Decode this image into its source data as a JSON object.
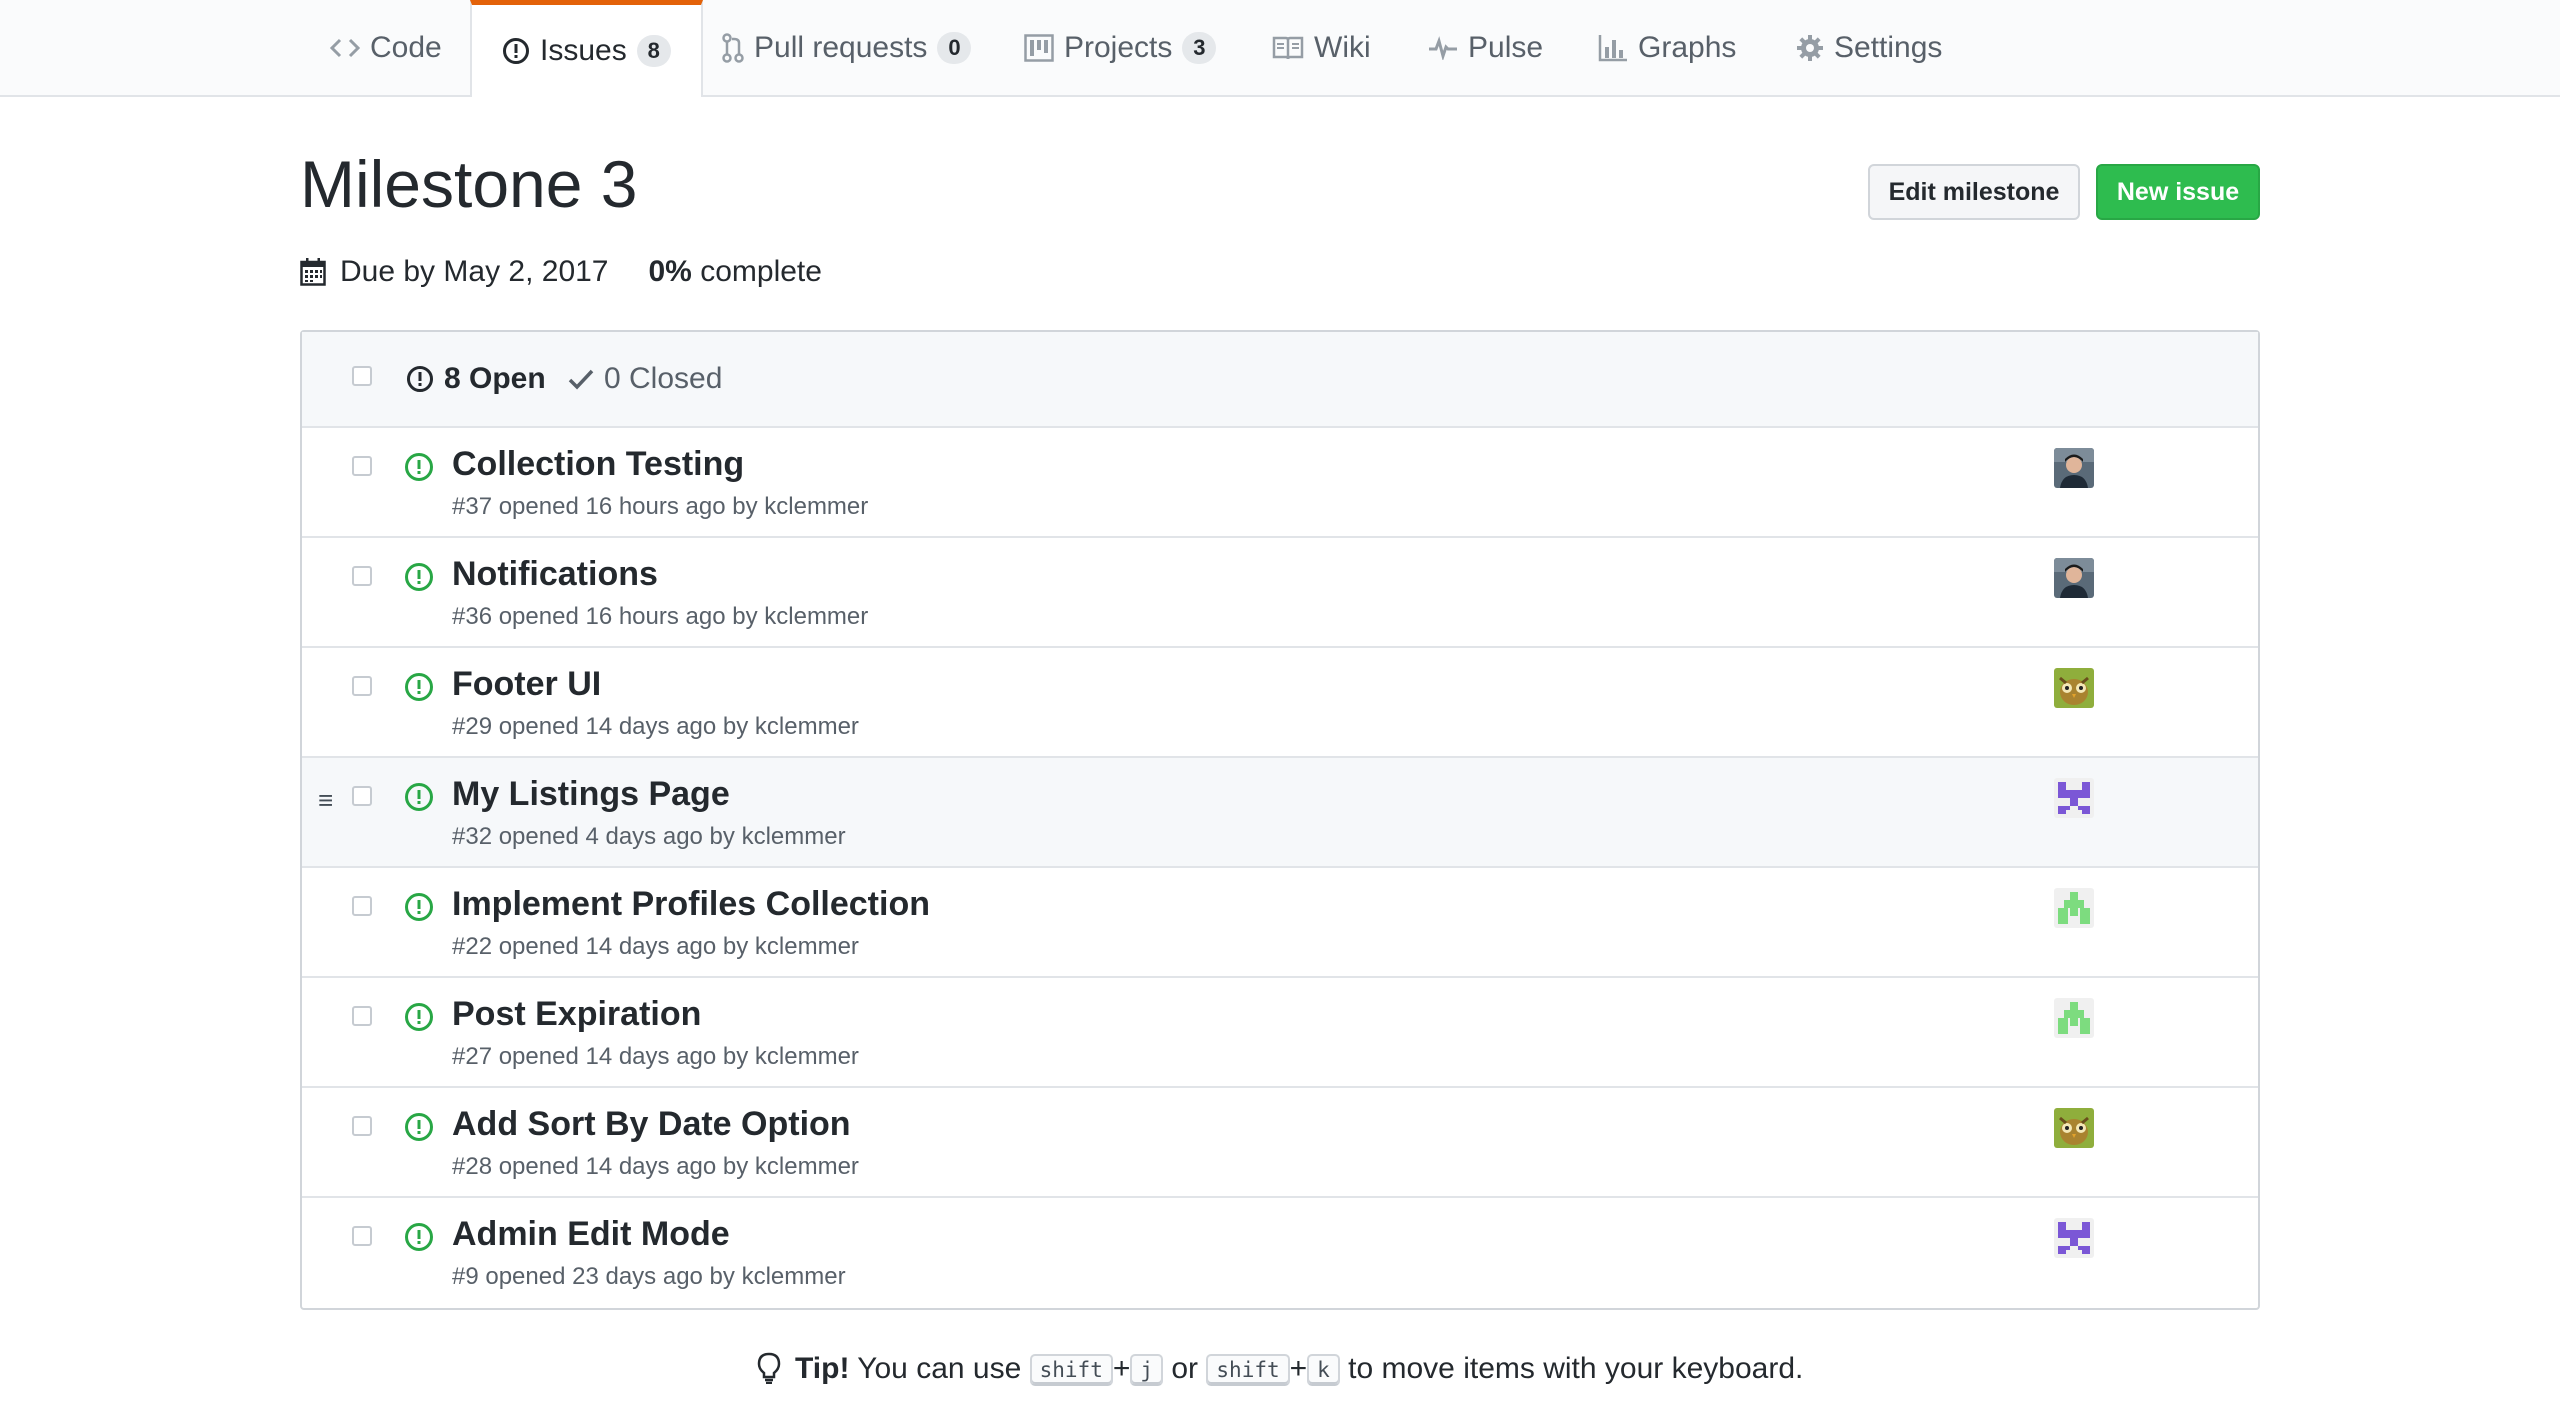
{
  "tabs": [
    {
      "label": "Code",
      "icon": "code-icon"
    },
    {
      "label": "Issues",
      "icon": "issue-opened-icon",
      "count": "8",
      "selected": true
    },
    {
      "label": "Pull requests",
      "icon": "git-pull-request-icon",
      "count": "0"
    },
    {
      "label": "Projects",
      "icon": "project-icon",
      "count": "3"
    },
    {
      "label": "Wiki",
      "icon": "book-icon"
    },
    {
      "label": "Pulse",
      "icon": "pulse-icon"
    },
    {
      "label": "Graphs",
      "icon": "graph-icon"
    },
    {
      "label": "Settings",
      "icon": "gear-icon"
    }
  ],
  "milestone": {
    "title": "Milestone 3",
    "due": "Due by May 2, 2017",
    "percent": "0%",
    "complete_label": "complete",
    "edit_label": "Edit milestone",
    "new_issue_label": "New issue"
  },
  "states": {
    "open_label": "8 Open",
    "closed_label": "0 Closed"
  },
  "issues": [
    {
      "title": "Collection Testing",
      "meta": "#37 opened 16 hours ago by kclemmer",
      "avatar": "photo"
    },
    {
      "title": "Notifications",
      "meta": "#36 opened 16 hours ago by kclemmer",
      "avatar": "photo"
    },
    {
      "title": "Footer UI",
      "meta": "#29 opened 14 days ago by kclemmer",
      "avatar": "owl"
    },
    {
      "title": "My Listings Page",
      "meta": "#32 opened 4 days ago by kclemmer",
      "avatar": "identicon-purple"
    },
    {
      "title": "Implement Profiles Collection",
      "meta": "#22 opened 14 days ago by kclemmer",
      "avatar": "identicon-green"
    },
    {
      "title": "Post Expiration",
      "meta": "#27 opened 14 days ago by kclemmer",
      "avatar": "identicon-green"
    },
    {
      "title": "Add Sort By Date Option",
      "meta": "#28 opened 14 days ago by kclemmer",
      "avatar": "owl"
    },
    {
      "title": "Admin Edit Mode",
      "meta": "#9 opened 23 days ago by kclemmer",
      "avatar": "identicon-purple"
    }
  ],
  "tip": {
    "label": "Tip!",
    "text_before": "You can use",
    "key_shift": "shift",
    "plus": "+",
    "key_j": "j",
    "or": "or",
    "key_k": "k",
    "text_after": "to move items with your keyboard."
  },
  "colors": {
    "accent_tab": "#e36209",
    "open_green": "#28a745",
    "new_issue_button": "#2ebc4f"
  }
}
